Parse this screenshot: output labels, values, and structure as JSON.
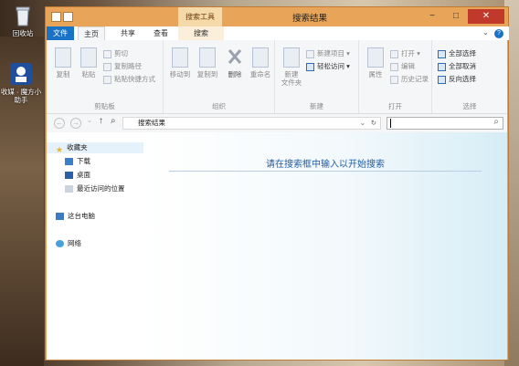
{
  "desktop": {
    "icons": [
      {
        "label": "回收站",
        "icon": "recycle-bin-icon"
      },
      {
        "label": "收媒 · 魔方小助手",
        "icon": "app-icon"
      }
    ]
  },
  "window": {
    "title": "搜索结果",
    "context_tab_title": "搜索工具",
    "caption_buttons": {
      "minimize": "−",
      "maximize": "□",
      "close": "✕"
    }
  },
  "tabs": {
    "file": "文件",
    "home": "主页",
    "share": "共享",
    "view": "查看",
    "search": "搜索",
    "expand_glyph": "⌄",
    "help_glyph": "?"
  },
  "ribbon": {
    "clipboard": {
      "label": "剪贴板",
      "copy": "复制",
      "paste": "粘贴",
      "cut": "剪切",
      "copy_path": "复制路径",
      "paste_shortcut": "粘贴快捷方式"
    },
    "organize": {
      "label": "组织",
      "move_to": "移动到",
      "copy_to": "复制到",
      "delete": "删除",
      "rename": "重命名"
    },
    "new": {
      "label": "新建",
      "new_folder_line1": "新建",
      "new_folder_line2": "文件夹",
      "new_item": "新建项目 ▾",
      "easy_access": "轻松访问 ▾"
    },
    "open": {
      "label": "打开",
      "properties": "属性",
      "open": "打开 ▾",
      "edit": "编辑",
      "history": "历史记录"
    },
    "select": {
      "label": "选择",
      "select_all": "全部选择",
      "select_none": "全部取消",
      "invert": "反向选择"
    }
  },
  "address": {
    "path": "搜索结果",
    "back": "←",
    "forward": "→",
    "up": "↑",
    "dropdown": "⌄",
    "refresh": "↻",
    "search_glyph": "⌕"
  },
  "nav": {
    "favorites": "收藏夹",
    "downloads": "下载",
    "desktop": "桌面",
    "recent": "最近访问的位置",
    "this_pc": "这台电脑",
    "network": "网络"
  },
  "main": {
    "hint": "请在搜索框中输入以开始搜索"
  },
  "colors": {
    "accent": "#1a72c4",
    "window_frame": "#e8a55a",
    "hint_text": "#1f5ea8"
  }
}
